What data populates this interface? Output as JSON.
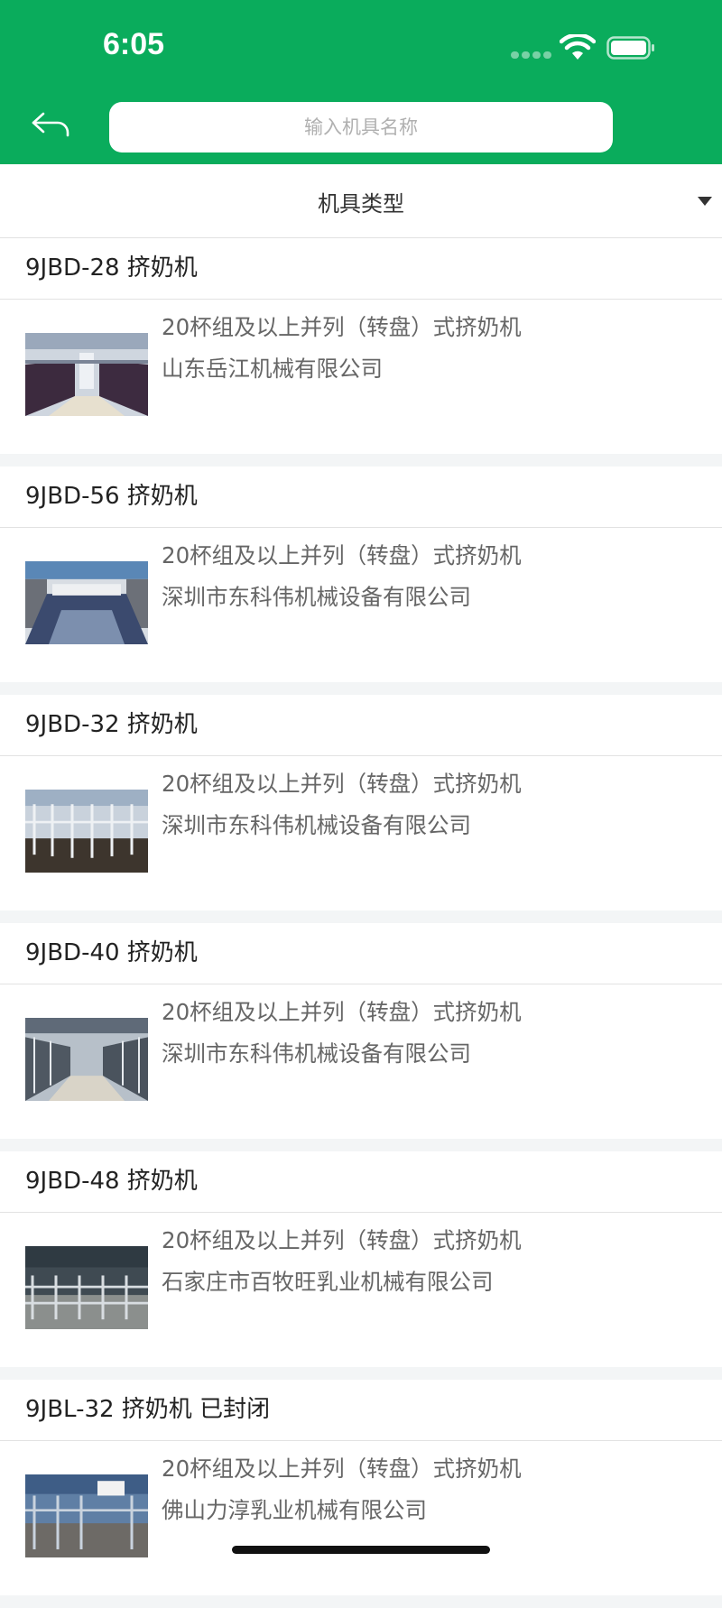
{
  "status_bar": {
    "time": "6:05"
  },
  "header": {
    "back_icon": "back-arrow-icon",
    "search_placeholder": "输入机具名称",
    "background_color": "#0aac5c"
  },
  "filter": {
    "label": "机具类型",
    "icon": "caret-down-icon"
  },
  "items": [
    {
      "title": "9JBD-28 挤奶机",
      "category": "20杯组及以上并列（转盘）式挤奶机",
      "company": "山东岳江机械有限公司"
    },
    {
      "title": "9JBD-56 挤奶机",
      "category": "20杯组及以上并列（转盘）式挤奶机",
      "company": "深圳市东科伟机械设备有限公司"
    },
    {
      "title": "9JBD-32 挤奶机",
      "category": "20杯组及以上并列（转盘）式挤奶机",
      "company": "深圳市东科伟机械设备有限公司"
    },
    {
      "title": "9JBD-40 挤奶机",
      "category": "20杯组及以上并列（转盘）式挤奶机",
      "company": "深圳市东科伟机械设备有限公司"
    },
    {
      "title": "9JBD-48 挤奶机",
      "category": "20杯组及以上并列（转盘）式挤奶机",
      "company": "石家庄市百牧旺乳业机械有限公司"
    },
    {
      "title": "9JBL-32 挤奶机 已封闭",
      "category": "20杯组及以上并列（转盘）式挤奶机",
      "company": "佛山力淳乳业机械有限公司"
    }
  ]
}
